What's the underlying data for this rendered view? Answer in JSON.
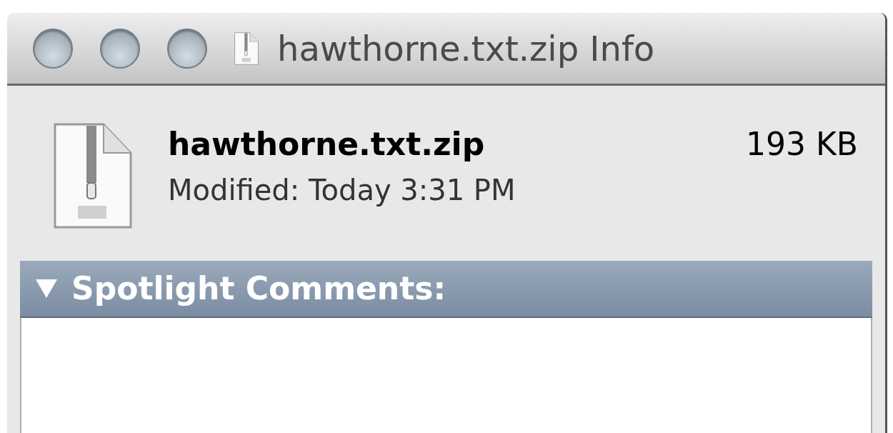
{
  "window": {
    "title": "hawthorne.txt.zip Info"
  },
  "file": {
    "name": "hawthorne.txt.zip",
    "size": "193 KB",
    "modified": "Modified: Today 3:31 PM"
  },
  "section": {
    "title": "Spotlight Comments:",
    "expanded": true
  }
}
